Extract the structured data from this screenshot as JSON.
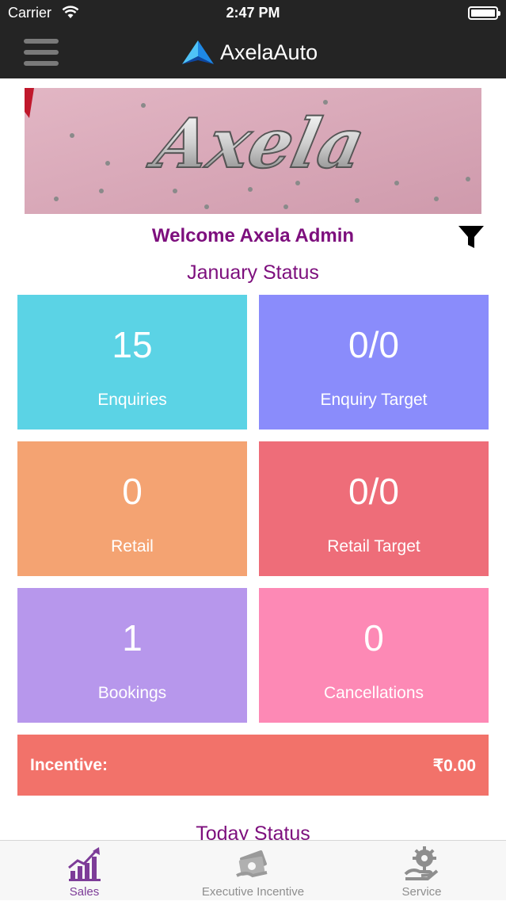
{
  "status_bar": {
    "carrier": "Carrier",
    "time": "2:47 PM"
  },
  "header": {
    "app_name": "AxelaAuto"
  },
  "banner": {
    "text": "Axela"
  },
  "welcome": {
    "text": "Welcome Axela Admin"
  },
  "month_status": {
    "title": "January Status"
  },
  "tiles": [
    {
      "value": "15",
      "label": "Enquiries",
      "color": "#5bd3e5"
    },
    {
      "value": "0/0",
      "label": "Enquiry Target",
      "color": "#8a8cfb"
    },
    {
      "value": "0",
      "label": "Retail",
      "color": "#f4a372"
    },
    {
      "value": "0/0",
      "label": "Retail Target",
      "color": "#ee6d79"
    },
    {
      "value": "1",
      "label": "Bookings",
      "color": "#b797ec"
    },
    {
      "value": "0",
      "label": "Cancellations",
      "color": "#fd89b5"
    }
  ],
  "incentive": {
    "label": "Incentive:",
    "amount": "₹0.00",
    "color": "#f2726a"
  },
  "today_status": {
    "title": "Today Status"
  },
  "tab_bar": {
    "items": [
      {
        "label": "Sales",
        "icon": "sales-chart-icon",
        "active": true
      },
      {
        "label": "Executive Incentive",
        "icon": "money-icon",
        "active": false
      },
      {
        "label": "Service",
        "icon": "service-gear-icon",
        "active": false
      }
    ]
  },
  "colors": {
    "header_bg": "#242424",
    "accent": "#7d0f7d",
    "tab_active": "#7d3c98",
    "tab_inactive": "#8e8e8e"
  }
}
